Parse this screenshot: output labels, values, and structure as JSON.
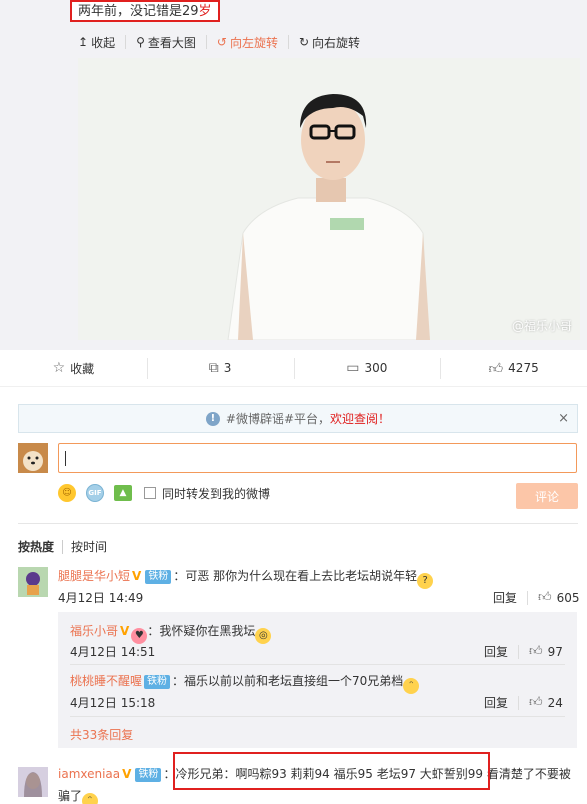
{
  "top_caption": {
    "prefix": "两年前，没记错是29",
    "suffix": "岁"
  },
  "media_toolbar": {
    "collapse": "收起",
    "view_large": "查看大图",
    "rotate_left": "向左旋转",
    "rotate_right": "向右旋转"
  },
  "photo": {
    "watermark": "@福乐小哥"
  },
  "actions": {
    "favorite": "收藏",
    "repost_count": "3",
    "comment_count": "300",
    "like_count": "4275"
  },
  "notice": {
    "prefix": "#微博辟谣#平台，",
    "link": "欢迎查阅！",
    "close": "×"
  },
  "composer": {
    "repost_label": "同时转发到我的微博",
    "submit": "评论",
    "gif_label": "GIF"
  },
  "sort_tabs": {
    "hot": "按热度",
    "time": "按时间"
  },
  "comments": [
    {
      "name": "腿腿是华小短",
      "badge": "铁粉",
      "text": "：可恶 那你为什么现在看上去比老坛胡说年轻",
      "time": "4月12日 14:49",
      "reply_label": "回复",
      "likes": "605"
    },
    {
      "name": "iamxeniaa",
      "badge": "铁粉",
      "text": "：冷形兄弟：啊吗粽93  莉莉94  福乐95  老坛97  大虾誓别99 看清楚了不要被",
      "text2": "骗了"
    }
  ],
  "replies": [
    {
      "name": "福乐小哥",
      "text": "：我怀疑你在黑我坛",
      "time": "4月12日 14:51",
      "reply_label": "回复",
      "likes": "97"
    },
    {
      "name": "桃桃睡不醒喔",
      "badge": "铁粉",
      "text": "：福乐以前以前和老坛直接组一个70兄弟档",
      "time": "4月12日 15:18",
      "reply_label": "回复",
      "likes": "24"
    }
  ],
  "more_replies": "共33条回复",
  "colors": {
    "accent": "#eb7350",
    "highlight_box": "#e0201f",
    "badge": "#5eb0e4"
  }
}
